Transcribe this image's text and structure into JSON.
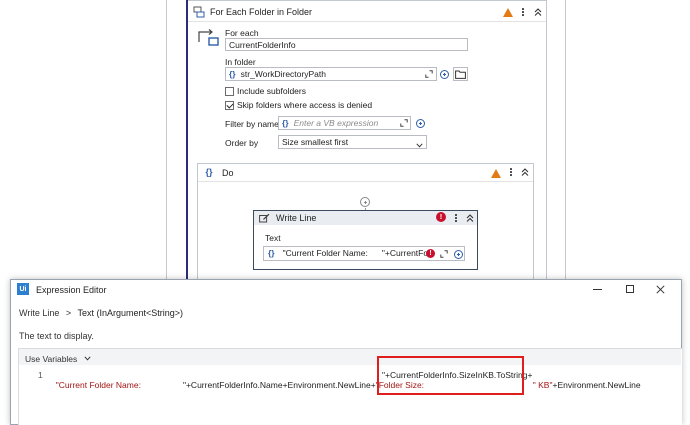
{
  "workflow": {
    "foreach_activity": {
      "title": "For Each Folder in Folder",
      "for_each_label": "For each",
      "for_each_value": "CurrentFolderInfo",
      "in_folder_label": "In folder",
      "in_folder_value": "str_WorkDirectoryPath",
      "include_subfolders_label": "Include subfolders",
      "include_subfolders_checked": false,
      "skip_folders_label": "Skip folders where access is denied",
      "skip_folders_checked": true,
      "filter_label": "Filter by name",
      "filter_placeholder": "Enter a VB expression",
      "order_label": "Order by",
      "order_value": "Size smallest first"
    },
    "do_sequence": {
      "title": "Do"
    },
    "write_line": {
      "title": "Write Line",
      "text_label": "Text",
      "text_value_part1": "\"Current Folder Name:",
      "text_value_part2": "\"+CurrentFol"
    }
  },
  "expression_editor": {
    "window_title": "Expression Editor",
    "app_icon_text": "Ui",
    "breadcrumb_prefix": "Write Line",
    "breadcrumb_separator": ">",
    "breadcrumb_current": "Text (InArgument<String>)",
    "description": "The text to display.",
    "use_variables_label": "Use Variables",
    "line_number": "1",
    "code_string1": "\"Current Folder Name:",
    "code_plain1": "\"+CurrentFolderInfo.Name+Environment.NewLine+",
    "code_string2": "\"Folder Size:",
    "code_highlight": "\"+CurrentFolderInfo.SizeInKB.ToString+",
    "code_string3": "\" KB\"",
    "code_plain2": "+Environment.NewLine",
    "highlight_color": "#e01e1e"
  },
  "colors": {
    "accent": "#2f5fa8",
    "warning": "#e27b14",
    "error": "#c8102e",
    "selection_border": "#2b2b7a"
  }
}
